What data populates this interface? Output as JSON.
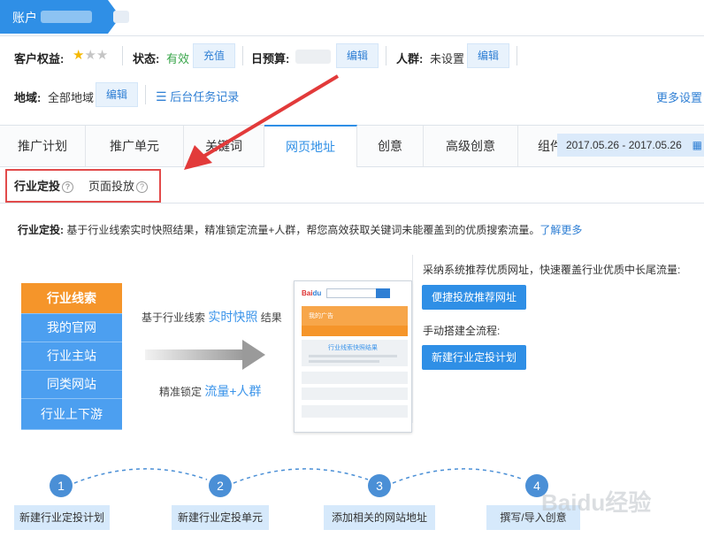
{
  "header": {
    "account_label": "账户",
    "colors": {
      "accent": "#2f8fe6",
      "highlight_border": "#e24b4b",
      "arrow": "#e23a3a"
    }
  },
  "info": {
    "rights_label": "客户权益:",
    "stars": {
      "total": 3,
      "filled": 1
    },
    "status_label": "状态:",
    "status_value": "有效",
    "recharge_label": "充值",
    "budget_label": "日预算:",
    "budget_edit": "编辑",
    "crowd_label": "人群:",
    "crowd_value": "未设置",
    "crowd_edit": "编辑",
    "region_label": "地域:",
    "region_value": "全部地域",
    "region_edit": "编辑",
    "task_log": "后台任务记录",
    "more_settings": "更多设置"
  },
  "tabs": [
    "推广计划",
    "推广单元",
    "关键词",
    "网页地址",
    "创意",
    "高级创意",
    "组件"
  ],
  "active_tab": 3,
  "date_range": "2017.05.26 - 2017.05.26",
  "subtabs": [
    "行业定投",
    "页面投放"
  ],
  "description": {
    "term": "行业定投:",
    "text": "基于行业线索实时快照结果，精准锁定流量+人群，帮您高效获取关键词未能覆盖到的优质搜索流量。",
    "link": "了解更多"
  },
  "illustration": {
    "industry_items": [
      "行业线索",
      "我的官网",
      "行业主站",
      "同类网站",
      "行业上下游"
    ],
    "note1_prefix": "基于行业线索",
    "note1_highlight": "实时快照",
    "note1_suffix": "结果",
    "note2_prefix": "精准锁定",
    "note2_highlight": "流量+人群",
    "mock_ad": "我的广告",
    "mock_result": "行业线索快照结果"
  },
  "actions": {
    "recommend_text": "采纳系统推荐优质网址，快速覆盖行业优质中长尾流量:",
    "recommend_button": "便捷投放推荐网址",
    "manual_text": "手动搭建全流程:",
    "manual_button": "新建行业定投计划"
  },
  "steps": [
    {
      "num": "1",
      "label": "新建行业定投计划"
    },
    {
      "num": "2",
      "label": "新建行业定投单元"
    },
    {
      "num": "3",
      "label": "添加相关的网站地址"
    },
    {
      "num": "4",
      "label": "撰写/导入创意"
    }
  ],
  "watermark": "Baidu经验"
}
